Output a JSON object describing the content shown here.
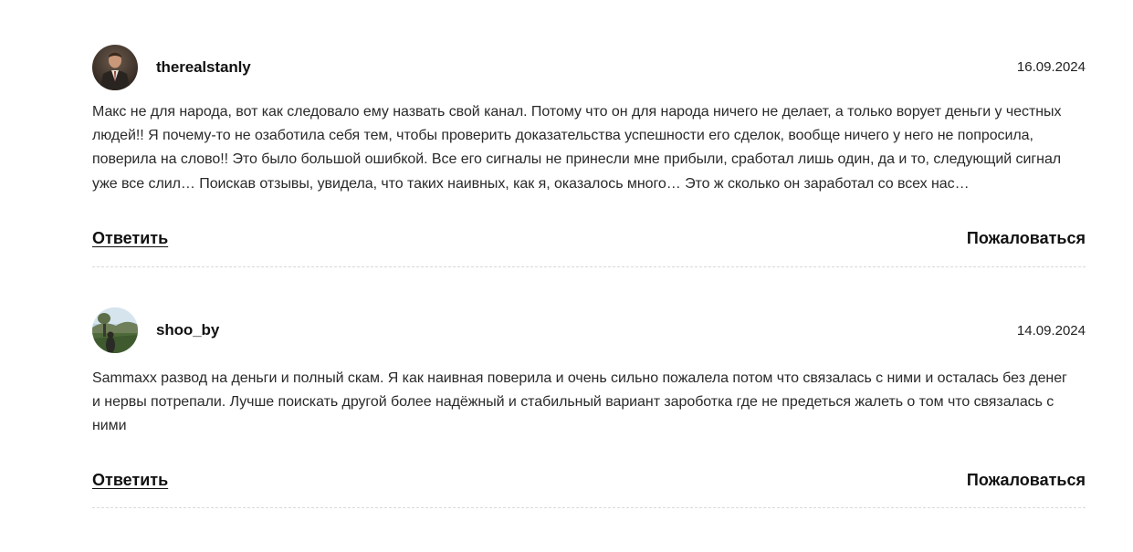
{
  "comments": [
    {
      "author": "therealstanly",
      "date": "16.09.2024",
      "avatar_icon": "user-photo-icon",
      "text": "Макс не для народа, вот как следовало ему назвать свой канал. Потому что он для народа ничего не делает, а только ворует деньги у честных людей!! Я почему-то не озаботила себя тем, чтобы проверить доказательства успешности его сделок, вообще ничего у него не попросила, поверила на слово!! Это было большой ошибкой. Все его сигналы не принесли мне прибыли, сработал лишь один, да и то, следующий сигнал уже все слил… Поискав отзывы, увидела, что таких наивных, как я, оказалось много… Это ж сколько он заработал со всех нас…",
      "reply_label": "Ответить",
      "report_label": "Пожаловаться"
    },
    {
      "author": "shoo_by",
      "date": "14.09.2024",
      "avatar_icon": "landscape-photo-icon",
      "text": "Sammaxx развод на деньги и полный скам. Я как наивная поверила и очень сильно пожалела потом что связалась с ними и осталась без денег и нервы потрепали. Лучше поискать другой более надёжный и стабильный вариант зароботка где не предеться жалеть о том что связалась с ними",
      "reply_label": "Ответить",
      "report_label": "Пожаловаться"
    }
  ],
  "colors": {
    "text": "#1a1a1a",
    "divider": "#d9d9d9",
    "background": "#ffffff"
  }
}
